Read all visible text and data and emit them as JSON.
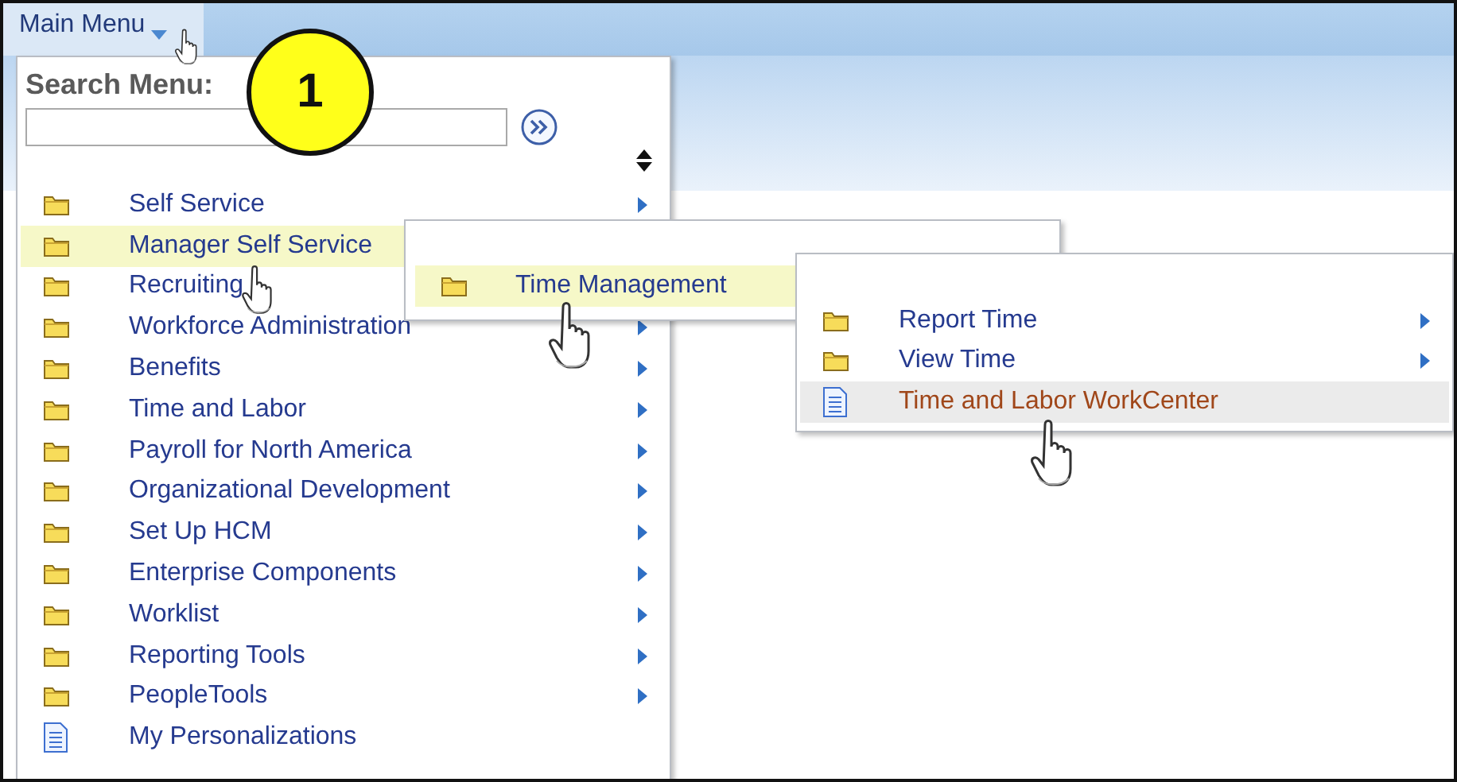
{
  "top_bar": {
    "menu_label": "Main Menu"
  },
  "main_menu": {
    "search_label": "Search Menu:",
    "items": [
      {
        "label": "Self Service",
        "kind": "folder",
        "has_submenu": true,
        "selected": false
      },
      {
        "label": "Manager Self Service",
        "kind": "folder",
        "has_submenu": false,
        "selected": true
      },
      {
        "label": "Recruiting",
        "kind": "folder",
        "has_submenu": false,
        "selected": false
      },
      {
        "label": "Workforce Administration",
        "kind": "folder",
        "has_submenu": true,
        "selected": false
      },
      {
        "label": "Benefits",
        "kind": "folder",
        "has_submenu": true,
        "selected": false
      },
      {
        "label": "Time and Labor",
        "kind": "folder",
        "has_submenu": true,
        "selected": false
      },
      {
        "label": "Payroll for North America",
        "kind": "folder",
        "has_submenu": true,
        "selected": false
      },
      {
        "label": "Organizational Development",
        "kind": "folder",
        "has_submenu": true,
        "selected": false
      },
      {
        "label": "Set Up HCM",
        "kind": "folder",
        "has_submenu": true,
        "selected": false
      },
      {
        "label": "Enterprise Components",
        "kind": "folder",
        "has_submenu": true,
        "selected": false
      },
      {
        "label": "Worklist",
        "kind": "folder",
        "has_submenu": true,
        "selected": false
      },
      {
        "label": "Reporting Tools",
        "kind": "folder",
        "has_submenu": true,
        "selected": false
      },
      {
        "label": "PeopleTools",
        "kind": "folder",
        "has_submenu": true,
        "selected": false
      },
      {
        "label": "My Personalizations",
        "kind": "page",
        "has_submenu": false,
        "selected": false
      }
    ]
  },
  "submenus": [
    {
      "items": [
        {
          "label": "Time Management",
          "kind": "folder",
          "has_submenu": false,
          "selected": true
        }
      ]
    },
    {
      "items": [
        {
          "label": "Report Time",
          "kind": "folder",
          "has_submenu": true,
          "selected": false
        },
        {
          "label": "View Time",
          "kind": "folder",
          "has_submenu": true,
          "selected": false
        },
        {
          "label": "Time and Labor WorkCenter",
          "kind": "page",
          "has_submenu": false,
          "selected": true
        }
      ]
    }
  ],
  "callout": {
    "number": "1"
  }
}
